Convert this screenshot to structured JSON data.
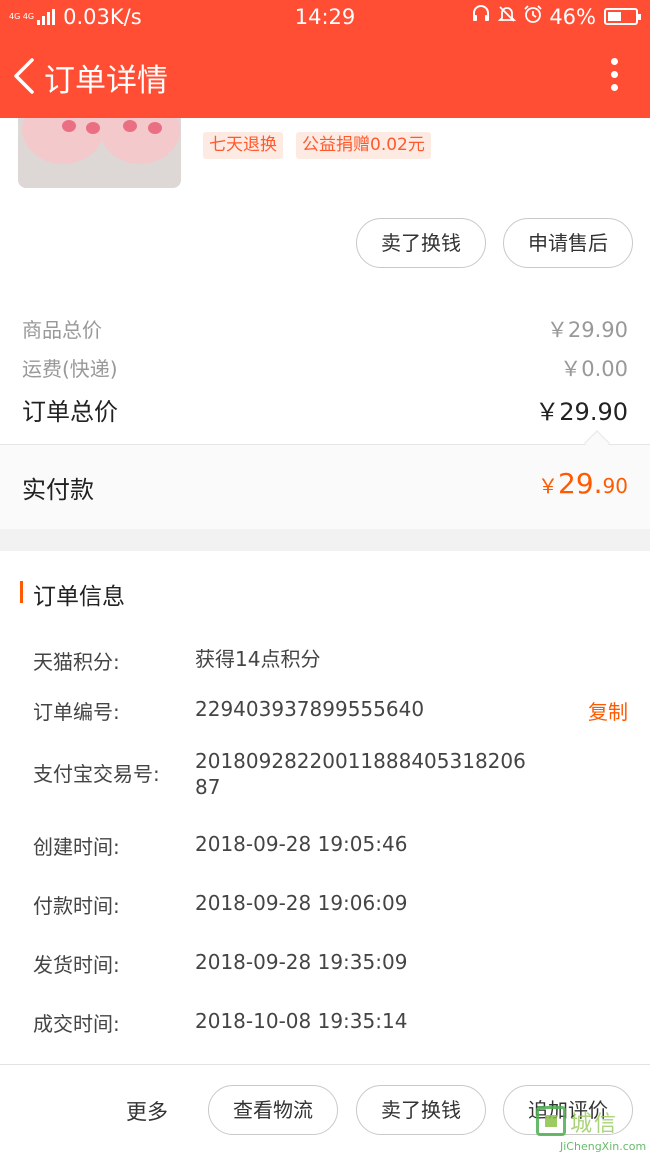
{
  "status_bar": {
    "network": "4G 4G",
    "speed": "0.03K/s",
    "time": "14:29",
    "battery": "46%",
    "icons": [
      "headset-icon",
      "bell-muted-icon",
      "alarm-icon",
      "battery-icon"
    ]
  },
  "nav": {
    "title": "订单详情",
    "back_icon": "chevron-left-icon",
    "more_icon": "more-vertical-icon"
  },
  "product": {
    "tags": [
      "七天退换",
      "公益捐赠0.02元"
    ],
    "actions": [
      "卖了换钱",
      "申请售后"
    ]
  },
  "prices": {
    "rows": [
      {
        "label": "商品总价",
        "value": "￥29.90"
      },
      {
        "label": "运费(快递)",
        "value": "￥0.00"
      }
    ],
    "total": {
      "label": "订单总价",
      "value": "￥29.90"
    },
    "paid": {
      "label": "实付款",
      "currency": "￥",
      "integer": "29.",
      "decimal": "90"
    }
  },
  "order_info": {
    "title": "订单信息",
    "copy_label": "复制",
    "rows": [
      {
        "key": "天猫积分:",
        "value": "获得14点积分"
      },
      {
        "key": "订单编号:",
        "value": "229403937899555640"
      },
      {
        "key": "支付宝交易号:",
        "value": "20180928220011888405318206 87"
      },
      {
        "key": "创建时间:",
        "value": "2018-09-28 19:05:46"
      },
      {
        "key": "付款时间:",
        "value": "2018-09-28 19:06:09"
      },
      {
        "key": "发货时间:",
        "value": "2018-09-28 19:35:09"
      },
      {
        "key": "成交时间:",
        "value": "2018-10-08 19:35:14"
      }
    ]
  },
  "bottom_bar": {
    "more": "更多",
    "buttons": [
      "查看物流",
      "卖了换钱",
      "追加评价"
    ]
  },
  "watermark": {
    "cn": "城信",
    "en": "JiChengXin.com"
  },
  "colors": {
    "brand": "#ff4e33",
    "accent": "#ff5a00"
  }
}
